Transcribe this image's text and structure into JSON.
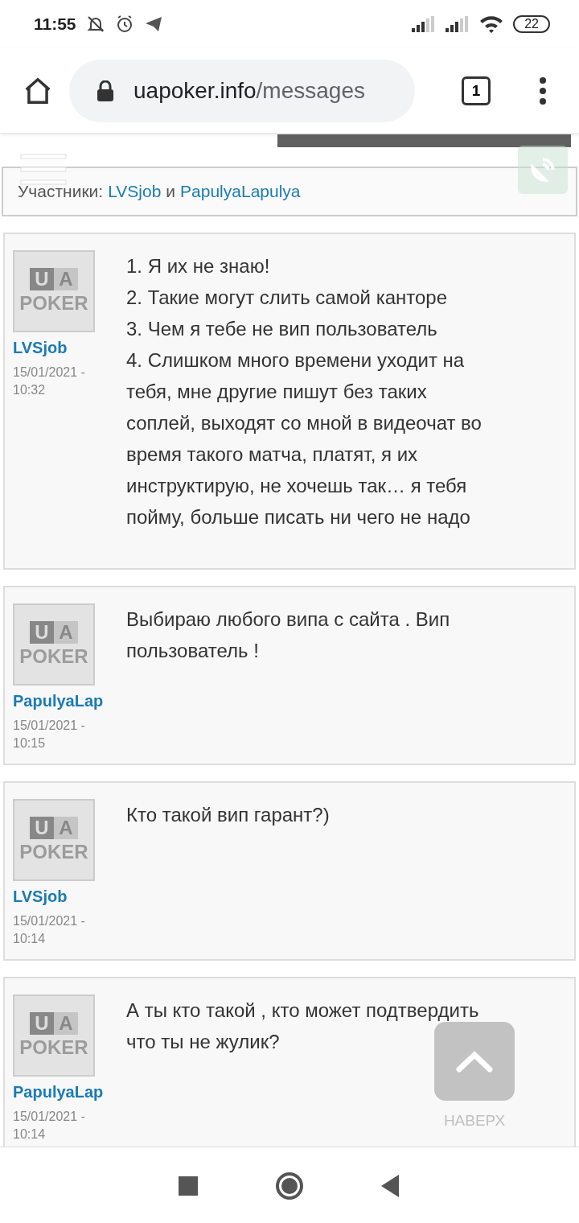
{
  "status_bar": {
    "time": "11:55",
    "battery": "22"
  },
  "browser": {
    "url_host": "uapoker.info",
    "url_path": "/messages",
    "tab_count": "1"
  },
  "participants": {
    "label": "Участники:",
    "users": [
      "LVSjob",
      "PapulyaLapulya"
    ],
    "joiner": "и"
  },
  "messages": [
    {
      "author": "LVSjob",
      "date": "15/01/2021 -",
      "time": "10:32",
      "avatar": {
        "letters": [
          "U",
          "A"
        ],
        "word": "POKER"
      },
      "lines": [
        "1. Я их не знаю!",
        "2. Такие могут слить самой канторе",
        "3. Чем я тебе не вип пользователь",
        "4. Слишком много времени уходит на",
        "тебя, мне другие пишут без таких",
        "соплей, выходят со мной в видеочат во",
        "время такого матча, платят, я их",
        "инструктирую, не хочешь так… я тебя",
        "пойму, больше писать ни чего не надо"
      ]
    },
    {
      "author": "PapulyaLap",
      "date": "15/01/2021 -",
      "time": "10:15",
      "avatar": {
        "letters": [
          "U",
          "A"
        ],
        "word": "POKER"
      },
      "lines": [
        "Выбираю любого випа с сайта . Вип",
        "пользователь !"
      ]
    },
    {
      "author": "LVSjob",
      "date": "15/01/2021 -",
      "time": "10:14",
      "avatar": {
        "letters": [
          "U",
          "A"
        ],
        "word": "POKER"
      },
      "lines": [
        "Кто такой вип гарант?)"
      ]
    },
    {
      "author": "PapulyaLap",
      "date": "15/01/2021 -",
      "time": "10:14",
      "avatar": {
        "letters": [
          "U",
          "A"
        ],
        "word": "POKER"
      },
      "lines": [
        "А ты кто такой , кто может подтвердить",
        "что ты не жулик?"
      ]
    }
  ],
  "scroll_top": {
    "label": "НАВЕРХ"
  }
}
